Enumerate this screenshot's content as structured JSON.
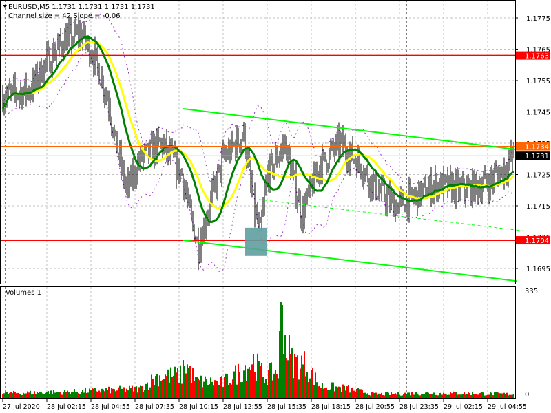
{
  "header": {
    "symbol_line": "EURUSD,M5  1.1731 1.1731 1.1731 1.1731",
    "channel_info": "Channel size = 42 Slope = -0.06"
  },
  "volume_panel": {
    "title": "Volumes 1",
    "max_label": "335",
    "min_label": "0"
  },
  "colors": {
    "up": "#008000",
    "down": "#ff0000",
    "level": "#ff0000",
    "channel": "#00ff00",
    "ma_fast": "#ffff00",
    "ma_slow": "#008000",
    "bands": "#9933cc",
    "box": "#5f9ea0",
    "ask": "#ff6600"
  },
  "chart_data": {
    "type": "ohlc",
    "symbol": "EURUSD",
    "timeframe": "M5",
    "price_ticks": [
      "1.1775",
      "1.1765",
      "1.1755",
      "1.1745",
      "1.1735",
      "1.1725",
      "1.1715",
      "1.1705",
      "1.1695"
    ],
    "ylim": [
      1.169,
      1.1782
    ],
    "time_ticks": [
      "27 Jul 2020",
      "28 Jul 02:15",
      "28 Jul 04:55",
      "28 Jul 07:35",
      "28 Jul 10:15",
      "28 Jul 12:55",
      "28 Jul 15:35",
      "28 Jul 18:15",
      "28 Jul 20:55",
      "28 Jul 23:35",
      "29 Jul 02:15",
      "29 Jul 04:55"
    ],
    "bars_count": 372,
    "close_keypoints": [
      [
        0,
        1.175
      ],
      [
        20,
        1.1752
      ],
      [
        30,
        1.176
      ],
      [
        45,
        1.1768
      ],
      [
        57,
        1.177
      ],
      [
        67,
        1.1762
      ],
      [
        77,
        1.1748
      ],
      [
        82,
        1.1735
      ],
      [
        90,
        1.172
      ],
      [
        100,
        1.173
      ],
      [
        115,
        1.1735
      ],
      [
        130,
        1.1725
      ],
      [
        137,
        1.171
      ],
      [
        142,
        1.1702
      ],
      [
        150,
        1.1715
      ],
      [
        160,
        1.173
      ],
      [
        175,
        1.1738
      ],
      [
        182,
        1.1715
      ],
      [
        187,
        1.1706
      ],
      [
        192,
        1.1725
      ],
      [
        205,
        1.1735
      ],
      [
        217,
        1.1712
      ],
      [
        230,
        1.1728
      ],
      [
        245,
        1.1735
      ],
      [
        260,
        1.1728
      ],
      [
        272,
        1.172
      ],
      [
        285,
        1.1715
      ],
      [
        300,
        1.1718
      ],
      [
        315,
        1.1722
      ],
      [
        335,
        1.172
      ],
      [
        350,
        1.1722
      ],
      [
        360,
        1.1725
      ],
      [
        371,
        1.1731
      ]
    ],
    "volume_keypoints": [
      [
        0,
        15
      ],
      [
        50,
        20
      ],
      [
        100,
        30
      ],
      [
        112,
        70
      ],
      [
        130,
        75
      ],
      [
        132,
        120
      ],
      [
        140,
        55
      ],
      [
        160,
        50
      ],
      [
        170,
        80
      ],
      [
        182,
        120
      ],
      [
        190,
        70
      ],
      [
        200,
        90
      ],
      [
        203,
        335
      ],
      [
        205,
        190
      ],
      [
        210,
        120
      ],
      [
        220,
        110
      ],
      [
        230,
        40
      ],
      [
        250,
        30
      ],
      [
        270,
        12
      ],
      [
        300,
        15
      ],
      [
        340,
        15
      ],
      [
        371,
        12
      ]
    ],
    "volume_ylim": [
      0,
      335
    ],
    "levels": [
      {
        "price": 1.1763,
        "label": "1.1763"
      },
      {
        "price": 1.1704,
        "label": "1.1704"
      }
    ],
    "ask_label": "1.1734",
    "bid_label": "1.1731",
    "ask": 1.1734,
    "bid": 1.1731,
    "channel": {
      "start_bar": 131,
      "end_bar": 371,
      "upper": [
        1.1746,
        1.1733
      ],
      "lower": [
        1.1704,
        1.1691
      ],
      "middle": [
        1.1717,
        1.1707
      ],
      "middle_start_bar": 186
    },
    "signal_box": {
      "from_bar": 176,
      "to_bar": 191,
      "top": 1.1708,
      "bottom": 1.1699
    },
    "ma_slow_period": 20,
    "ma_fast_period": 30,
    "bands_period": 20
  }
}
